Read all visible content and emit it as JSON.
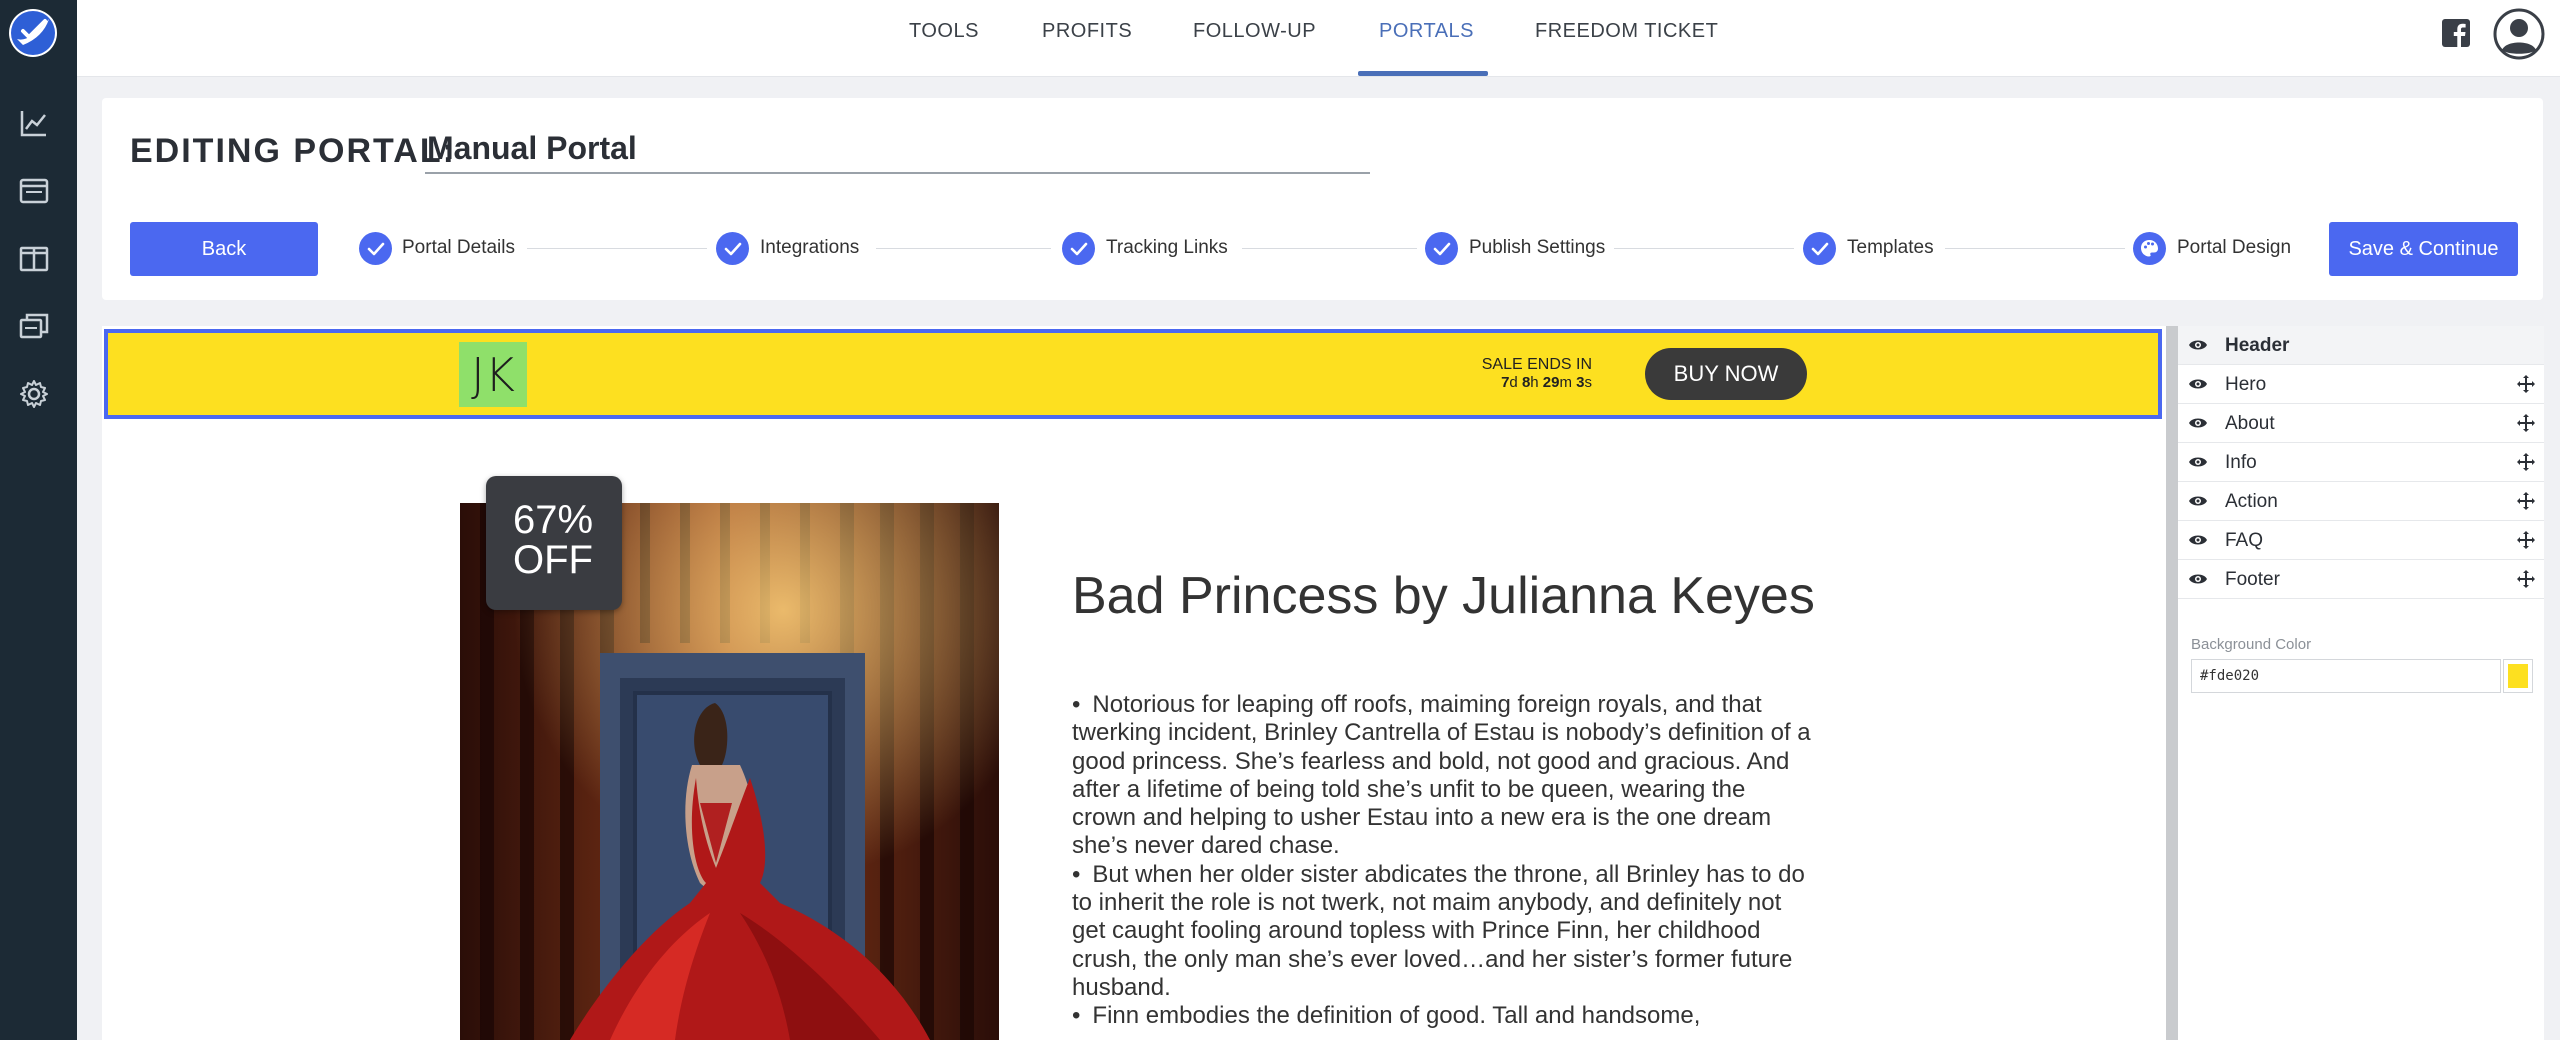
{
  "nav": {
    "items": [
      "TOOLS",
      "PROFITS",
      "FOLLOW-UP",
      "PORTALS",
      "FREEDOM TICKET"
    ],
    "active": "PORTALS"
  },
  "sidebar": {
    "icons": [
      "analytics-icon",
      "browser-window-icon",
      "columns-layout-icon",
      "copy-windows-icon",
      "settings-icon"
    ]
  },
  "editor": {
    "heading": "EDITING PORTAL:",
    "portal_name": "Manual Portal",
    "back_label": "Back",
    "save_label": "Save & Continue",
    "steps": [
      "Portal Details",
      "Integrations",
      "Tracking Links",
      "Publish Settings",
      "Templates",
      "Portal Design"
    ]
  },
  "preview": {
    "logo_text": "JK",
    "sale_ends_label": "SALE ENDS IN",
    "countdown": {
      "d": "7",
      "h": "8",
      "m": "29",
      "s": "3"
    },
    "countdown_units": {
      "d": "d",
      "h": "h",
      "m": "m",
      "s": "s"
    },
    "buy_now_label": "BUY NOW",
    "discount_percent": "67%",
    "discount_off": "OFF",
    "book_title": "Bad Princess by Julianna Keyes",
    "bullets": [
      "Notorious for leaping off roofs, maiming foreign royals, and that twerking incident, Brinley Cantrella of Estau is nobody’s definition of a good princess. She’s fearless and bold, not good and gracious. And after a lifetime of being told she’s unfit to be queen, wearing the crown and helping to usher Estau into a new era is the one dream she’s never dared chase.",
      "But when her older sister abdicates the throne, all Brinley has to do to inherit the role is not twerk, not maim anybody, and definitely not get caught fooling around topless with Prince Finn, her childhood crush, the only man she’s ever loved…and her sister’s former future husband.",
      "Finn embodies the definition of good. Tall and handsome, "
    ]
  },
  "panel": {
    "sections": [
      "Header",
      "Hero",
      "About",
      "Info",
      "Action",
      "FAQ",
      "Footer"
    ],
    "selected": "Header",
    "bg_color_label": "Background Color",
    "bg_color_value": "#fde020"
  },
  "colors": {
    "accent": "#4b68f0",
    "nav_active": "#4a6fb8",
    "sidebar": "#1c2a35",
    "header_bg": "#fde020",
    "logo_bg": "#8fe06a"
  }
}
